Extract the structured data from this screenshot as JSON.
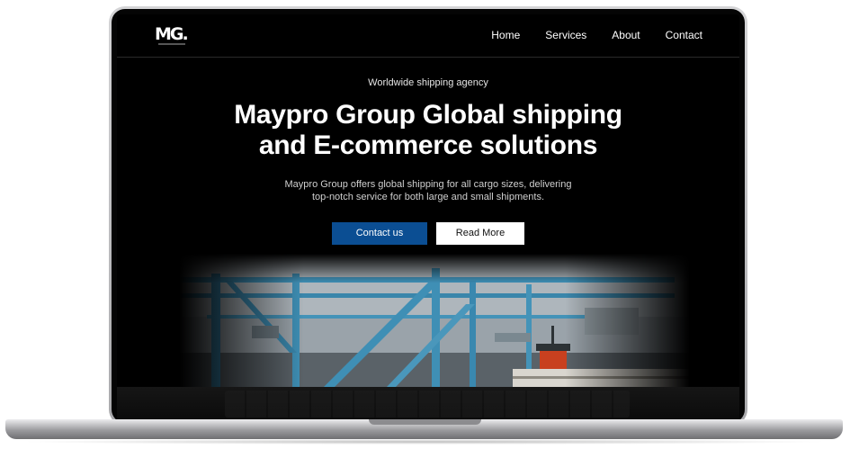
{
  "site": {
    "logo_text": "MG.",
    "nav": {
      "items": [
        {
          "label": "Home"
        },
        {
          "label": "Services"
        },
        {
          "label": "About"
        },
        {
          "label": "Contact"
        }
      ]
    },
    "hero": {
      "eyebrow": "Worldwide shipping agency",
      "title_line1": "Maypro Group Global shipping",
      "title_line2": "and E-commerce solutions",
      "subtitle_line1": "Maypro Group offers global shipping for all cargo sizes, delivering",
      "subtitle_line2": "top-notch service for both large and small shipments.",
      "primary_button": "Contact us",
      "secondary_button": "Read More",
      "image": "port-cranes-and-ship-photo"
    }
  },
  "colors": {
    "screen_background": "#000000",
    "primary_button": "#0b4e93",
    "crane": "#3f8fb5",
    "laptop_frame": "#c2c2c4"
  }
}
